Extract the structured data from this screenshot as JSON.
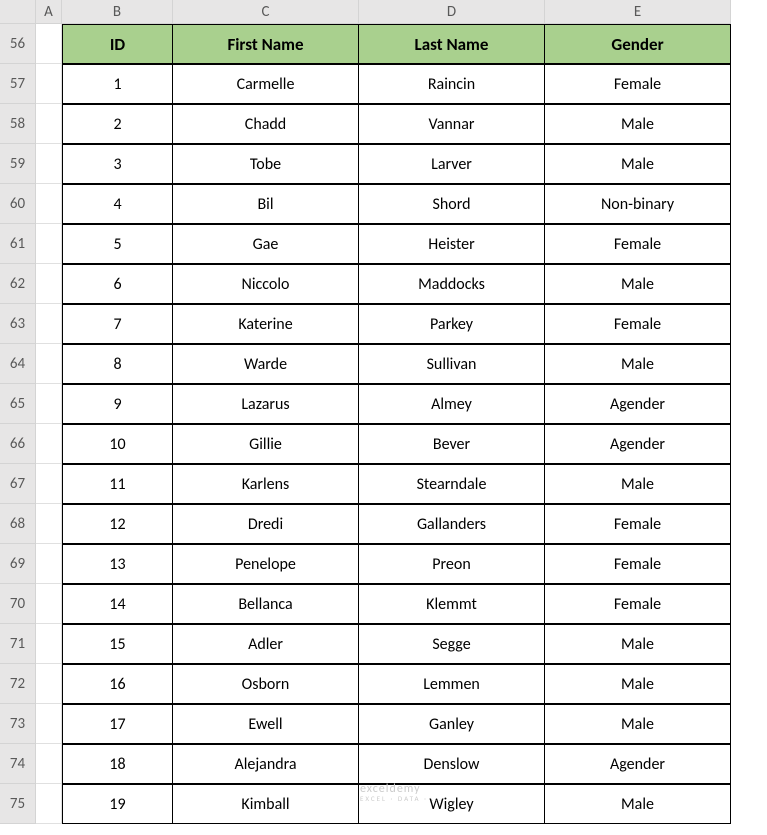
{
  "columns": [
    "",
    "A",
    "B",
    "C",
    "D",
    "E"
  ],
  "rowStart": 56,
  "headers": [
    "ID",
    "First Name",
    "Last Name",
    "Gender"
  ],
  "rows": [
    {
      "id": "1",
      "first": "Carmelle",
      "last": "Raincin",
      "gender": "Female"
    },
    {
      "id": "2",
      "first": "Chadd",
      "last": "Vannar",
      "gender": "Male"
    },
    {
      "id": "3",
      "first": "Tobe",
      "last": "Larver",
      "gender": "Male"
    },
    {
      "id": "4",
      "first": "Bil",
      "last": "Shord",
      "gender": "Non-binary"
    },
    {
      "id": "5",
      "first": "Gae",
      "last": "Heister",
      "gender": "Female"
    },
    {
      "id": "6",
      "first": "Niccolo",
      "last": "Maddocks",
      "gender": "Male"
    },
    {
      "id": "7",
      "first": "Katerine",
      "last": "Parkey",
      "gender": "Female"
    },
    {
      "id": "8",
      "first": "Warde",
      "last": "Sullivan",
      "gender": "Male"
    },
    {
      "id": "9",
      "first": "Lazarus",
      "last": "Almey",
      "gender": "Agender"
    },
    {
      "id": "10",
      "first": "Gillie",
      "last": "Bever",
      "gender": "Agender"
    },
    {
      "id": "11",
      "first": "Karlens",
      "last": "Stearndale",
      "gender": "Male"
    },
    {
      "id": "12",
      "first": "Dredi",
      "last": "Gallanders",
      "gender": "Female"
    },
    {
      "id": "13",
      "first": "Penelope",
      "last": "Preon",
      "gender": "Female"
    },
    {
      "id": "14",
      "first": "Bellanca",
      "last": "Klemmt",
      "gender": "Female"
    },
    {
      "id": "15",
      "first": "Adler",
      "last": "Segge",
      "gender": "Male"
    },
    {
      "id": "16",
      "first": "Osborn",
      "last": "Lemmen",
      "gender": "Male"
    },
    {
      "id": "17",
      "first": "Ewell",
      "last": "Ganley",
      "gender": "Male"
    },
    {
      "id": "18",
      "first": "Alejandra",
      "last": "Denslow",
      "gender": "Agender"
    },
    {
      "id": "19",
      "first": "Kimball",
      "last": "Wigley",
      "gender": "Male"
    }
  ],
  "watermark": {
    "main": "exceldemy",
    "sub": "EXCEL · DATA · ..."
  }
}
